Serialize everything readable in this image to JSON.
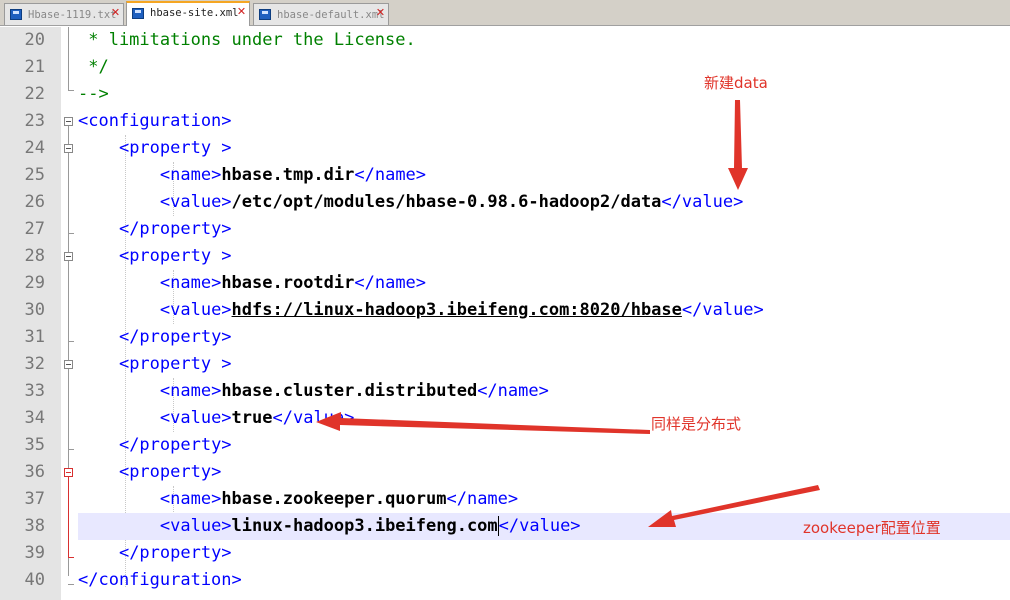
{
  "tabs": [
    {
      "label": "Hbase-1119.txt",
      "close": "✕",
      "active": false
    },
    {
      "label": "hbase-site.xml",
      "close": "✕",
      "active": true
    },
    {
      "label": "hbase-default.xml",
      "close": "✕",
      "active": false
    }
  ],
  "line_numbers": [
    "20",
    "21",
    "22",
    "23",
    "24",
    "25",
    "26",
    "27",
    "28",
    "29",
    "30",
    "31",
    "32",
    "33",
    "34",
    "35",
    "36",
    "37",
    "38",
    "39",
    "40"
  ],
  "code": {
    "l20": " * limitations under the License.",
    "l21": " */",
    "l22": "-->",
    "l23_open": "<configuration>",
    "prop_open": "<property >",
    "prop_open_nospace": "<property>",
    "prop_close": "</property>",
    "name_open": "<name>",
    "name_close": "</name>",
    "value_open": "<value>",
    "value_close": "</value>",
    "config_close": "</configuration>",
    "properties": [
      {
        "name": "hbase.tmp.dir",
        "value": "/etc/opt/modules/hbase-0.98.6-hadoop2/data"
      },
      {
        "name": "hbase.rootdir",
        "value": "hdfs://linux-hadoop3.ibeifeng.com:8020/hbase"
      },
      {
        "name": "hbase.cluster.distributed",
        "value": "true"
      },
      {
        "name": "hbase.zookeeper.quorum",
        "value": "linux-hadoop3.ibeifeng.com"
      }
    ]
  },
  "annotations": {
    "data_note": "新建data",
    "distributed_note": "同样是分布式",
    "zookeeper_note": "zookeeper配置位置"
  },
  "colors": {
    "comment": "#008000",
    "tag": "#0000ff",
    "annotation": "#e0342a",
    "active_line": "#e8e8ff"
  }
}
